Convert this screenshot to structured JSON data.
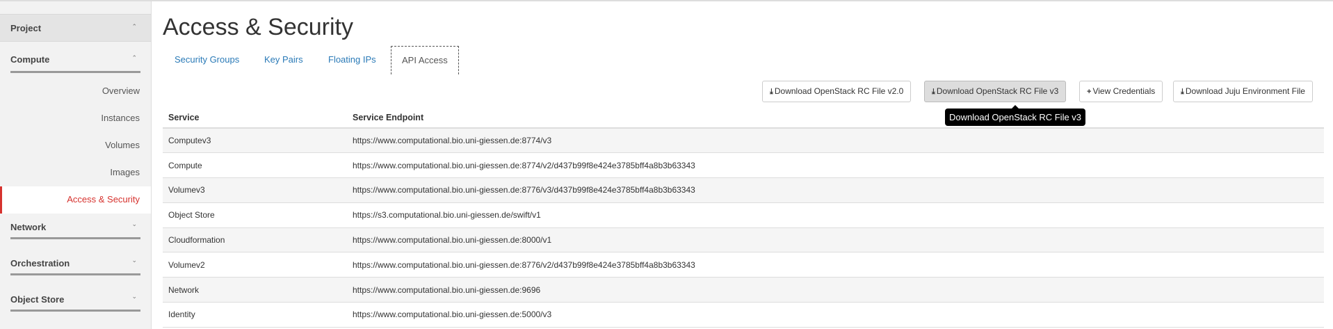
{
  "sidebar": {
    "project": "Project",
    "compute": "Compute",
    "compute_items": [
      "Overview",
      "Instances",
      "Volumes",
      "Images",
      "Access & Security"
    ],
    "network": "Network",
    "orchestration": "Orchestration",
    "object_store": "Object Store"
  },
  "page_title": "Access & Security",
  "tabs": [
    "Security Groups",
    "Key Pairs",
    "Floating IPs",
    "API Access"
  ],
  "buttons": {
    "rc_v2": "Download OpenStack RC File v2.0",
    "rc_v3": "Download OpenStack RC File v3",
    "view_credentials": "View Credentials",
    "juju": "Download Juju Environment File"
  },
  "tooltip": "Download OpenStack RC File v3",
  "table": {
    "headers": [
      "Service",
      "Service Endpoint"
    ],
    "rows": [
      [
        "Computev3",
        "https://www.computational.bio.uni-giessen.de:8774/v3"
      ],
      [
        "Compute",
        "https://www.computational.bio.uni-giessen.de:8774/v2/d437b99f8e424e3785bff4a8b3b63343"
      ],
      [
        "Volumev3",
        "https://www.computational.bio.uni-giessen.de:8776/v3/d437b99f8e424e3785bff4a8b3b63343"
      ],
      [
        "Object Store",
        "https://s3.computational.bio.uni-giessen.de/swift/v1"
      ],
      [
        "Cloudformation",
        "https://www.computational.bio.uni-giessen.de:8000/v1"
      ],
      [
        "Volumev2",
        "https://www.computational.bio.uni-giessen.de:8776/v2/d437b99f8e424e3785bff4a8b3b63343"
      ],
      [
        "Network",
        "https://www.computational.bio.uni-giessen.de:9696"
      ],
      [
        "Identity",
        "https://www.computational.bio.uni-giessen.de:5000/v3"
      ]
    ]
  },
  "colors": {
    "accent": "#d6322e",
    "link": "#2a7ab7"
  }
}
